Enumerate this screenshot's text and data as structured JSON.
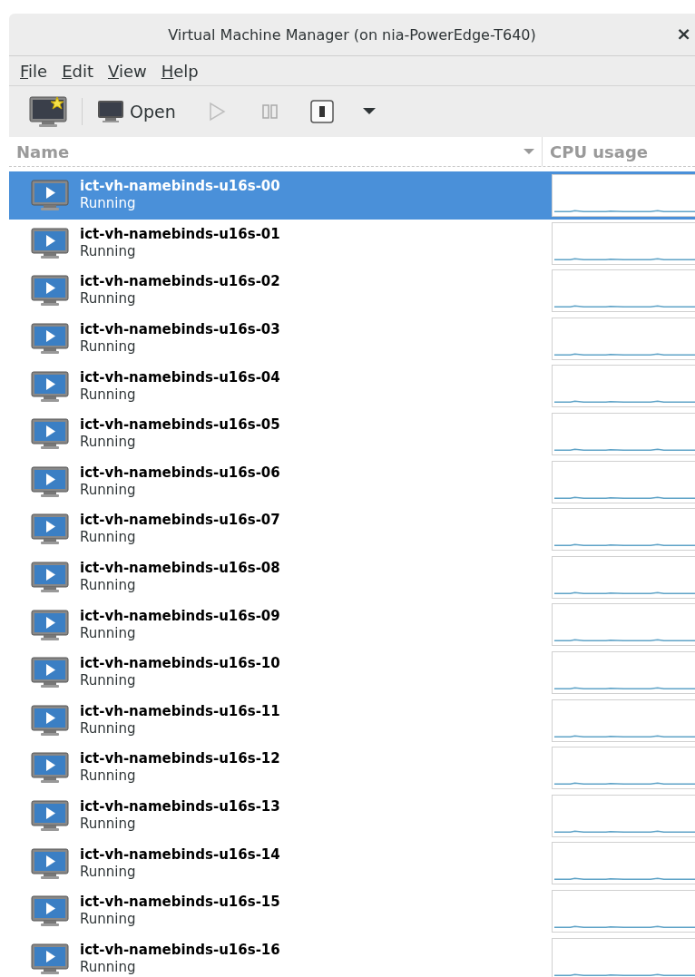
{
  "window": {
    "title": "Virtual Machine Manager (on nia-PowerEdge-T640)",
    "close": "×"
  },
  "menu": [
    "File",
    "Edit",
    "View",
    "Help"
  ],
  "toolbar": {
    "open_label": "Open",
    "play_disabled": true,
    "pause_disabled": true
  },
  "table": {
    "columns": [
      "Name",
      "CPU usage"
    ],
    "rows": [
      {
        "name": "ict-vh-namebinds-u16s-00",
        "status": "Running",
        "selected": true
      },
      {
        "name": "ict-vh-namebinds-u16s-01",
        "status": "Running",
        "selected": false
      },
      {
        "name": "ict-vh-namebinds-u16s-02",
        "status": "Running",
        "selected": false
      },
      {
        "name": "ict-vh-namebinds-u16s-03",
        "status": "Running",
        "selected": false
      },
      {
        "name": "ict-vh-namebinds-u16s-04",
        "status": "Running",
        "selected": false
      },
      {
        "name": "ict-vh-namebinds-u16s-05",
        "status": "Running",
        "selected": false
      },
      {
        "name": "ict-vh-namebinds-u16s-06",
        "status": "Running",
        "selected": false
      },
      {
        "name": "ict-vh-namebinds-u16s-07",
        "status": "Running",
        "selected": false
      },
      {
        "name": "ict-vh-namebinds-u16s-08",
        "status": "Running",
        "selected": false
      },
      {
        "name": "ict-vh-namebinds-u16s-09",
        "status": "Running",
        "selected": false
      },
      {
        "name": "ict-vh-namebinds-u16s-10",
        "status": "Running",
        "selected": false
      },
      {
        "name": "ict-vh-namebinds-u16s-11",
        "status": "Running",
        "selected": false
      },
      {
        "name": "ict-vh-namebinds-u16s-12",
        "status": "Running",
        "selected": false
      },
      {
        "name": "ict-vh-namebinds-u16s-13",
        "status": "Running",
        "selected": false
      },
      {
        "name": "ict-vh-namebinds-u16s-14",
        "status": "Running",
        "selected": false
      },
      {
        "name": "ict-vh-namebinds-u16s-15",
        "status": "Running",
        "selected": false
      },
      {
        "name": "ict-vh-namebinds-u16s-16",
        "status": "Running",
        "selected": false
      }
    ]
  }
}
